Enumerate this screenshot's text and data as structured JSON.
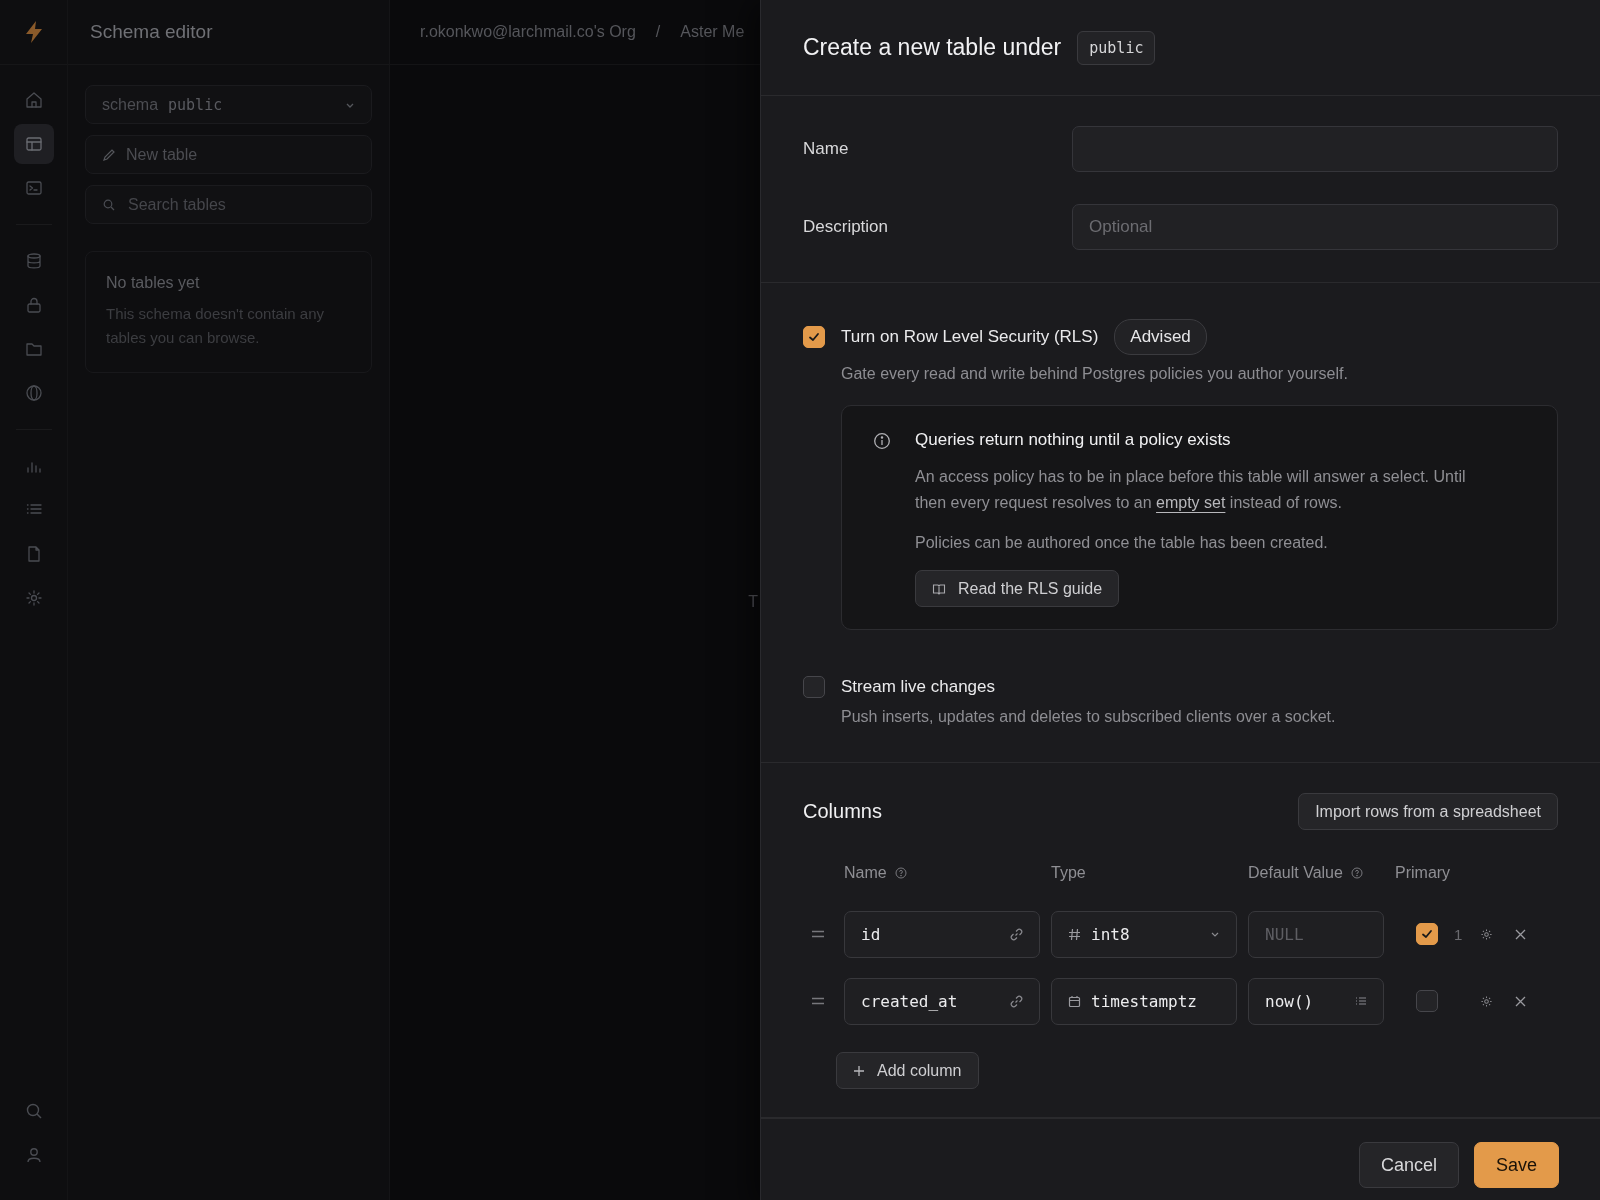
{
  "app": {
    "page_title": "Schema editor",
    "breadcrumb": [
      "r.okonkwo@larchmail.co's Org",
      "Aster Me"
    ],
    "separator": "/"
  },
  "rail_items": [
    {
      "selected": false
    },
    {
      "selected": true
    },
    {
      "selected": false
    },
    {
      "selected": false
    },
    {
      "selected": false
    },
    {
      "selected": false
    },
    {
      "selected": false
    },
    {
      "selected": false
    },
    {
      "selected": false
    },
    {
      "selected": false
    },
    {
      "selected": false
    }
  ],
  "sidebar": {
    "schema_label": "schema",
    "schema_value": "public",
    "new_table": "New table",
    "search_placeholder": "Search tables",
    "empty_title": "No tables yet",
    "empty_text": "This schema doesn't contain any tables you can browse."
  },
  "main_hint": "T",
  "panel": {
    "title": "Create a new table under",
    "schema_tag": "public",
    "fields": [
      {
        "label": "Name"
      },
      {
        "label": "Description",
        "placeholder": "Optional"
      }
    ],
    "options": [
      {
        "label": "Turn on Row Level Security (RLS)",
        "checked": true,
        "badge": "Advised",
        "description": "Gate every read and write behind Postgres policies you author yourself.",
        "notice": {
          "title": "Queries return nothing until a policy exists",
          "text_before": "An access policy has to be in place before this table will answer a select. Until then every request resolves to an",
          "link": "empty set",
          "text_after": "instead of rows.",
          "note": "Policies can be authored once the table has been created.",
          "button": "Read the RLS guide"
        }
      },
      {
        "label": "Stream live changes",
        "checked": false,
        "description": "Push inserts, updates and deletes to subscribed clients over a socket."
      }
    ],
    "columns_title": "Columns",
    "import_button": "Import rows from a spreadsheet",
    "column_headers": [
      {
        "label": "Name",
        "help": true
      },
      {
        "label": "Type",
        "help": false
      },
      {
        "label": "Default Value",
        "help": true
      },
      {
        "label": "Primary",
        "help": false
      }
    ],
    "columns": [
      {
        "name": "id",
        "type": "int8",
        "kind": "number",
        "type_dropdown": true,
        "default_placeholder": "NULL",
        "primary": true,
        "order": "1"
      },
      {
        "name": "created_at",
        "type": "timestamptz",
        "kind": "date",
        "type_dropdown": false,
        "default_value": "now()",
        "primary": false
      }
    ],
    "add_column": "Add column",
    "buttons": [
      {
        "label": "Cancel",
        "kind": "secondary"
      },
      {
        "label": "Save",
        "kind": "primary"
      }
    ]
  }
}
